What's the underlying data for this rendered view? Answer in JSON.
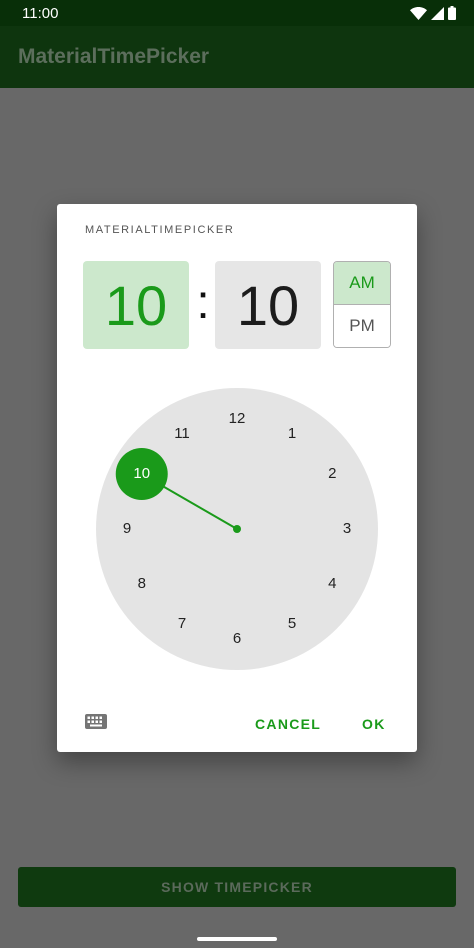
{
  "status_bar": {
    "time": "11:00",
    "icons": [
      "wifi-icon",
      "signal-icon",
      "battery-icon"
    ]
  },
  "app_bar": {
    "title": "MaterialTimePicker"
  },
  "dialog": {
    "title": "MATERIALTIMEPICKER",
    "hour": "10",
    "separator": ":",
    "minute": "10",
    "am_label": "AM",
    "pm_label": "PM",
    "selected_period": "AM",
    "clock": {
      "numbers": [
        "12",
        "1",
        "2",
        "3",
        "4",
        "5",
        "6",
        "7",
        "8",
        "9",
        "10",
        "11"
      ],
      "selected": "10"
    },
    "keyboard_icon": "keyboard-icon",
    "cancel_label": "CANCEL",
    "ok_label": "OK"
  },
  "show_button_label": "SHOW TIMEPICKER",
  "colors": {
    "accent": "#1a9a1a",
    "accent_light": "#cce8cc",
    "app_bar": "#0e350e",
    "status_bar": "#082f08",
    "scrim": "#686868"
  }
}
